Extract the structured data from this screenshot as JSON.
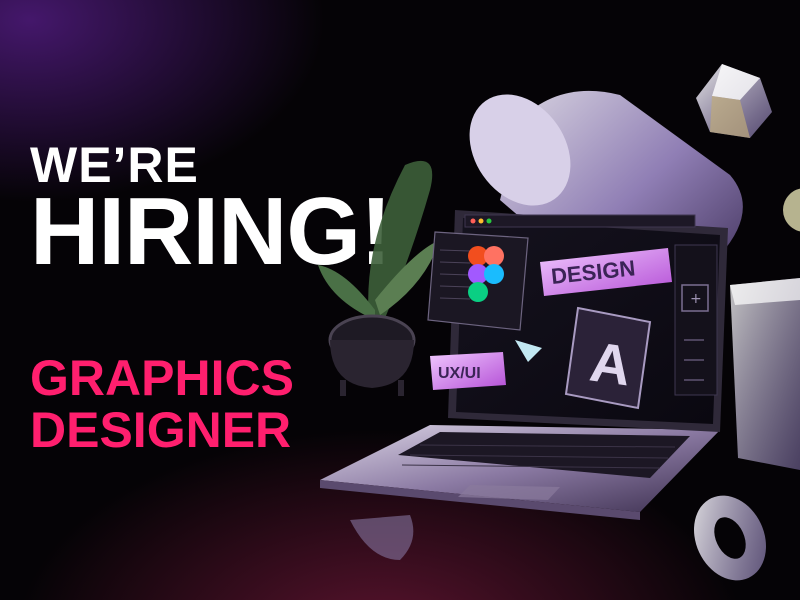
{
  "headline": {
    "line1": "WE’RE",
    "line2": "HIRING!"
  },
  "role": {
    "line1": "GRAPHICS",
    "line2": "DESIGNER"
  },
  "illustration": {
    "design_tag": "DESIGN",
    "letter_card": "A",
    "uxui_tag": "UX/UI"
  },
  "colors": {
    "accent_pink": "#ff1f6e",
    "headline_white": "#ffffff",
    "background": "#050306"
  }
}
